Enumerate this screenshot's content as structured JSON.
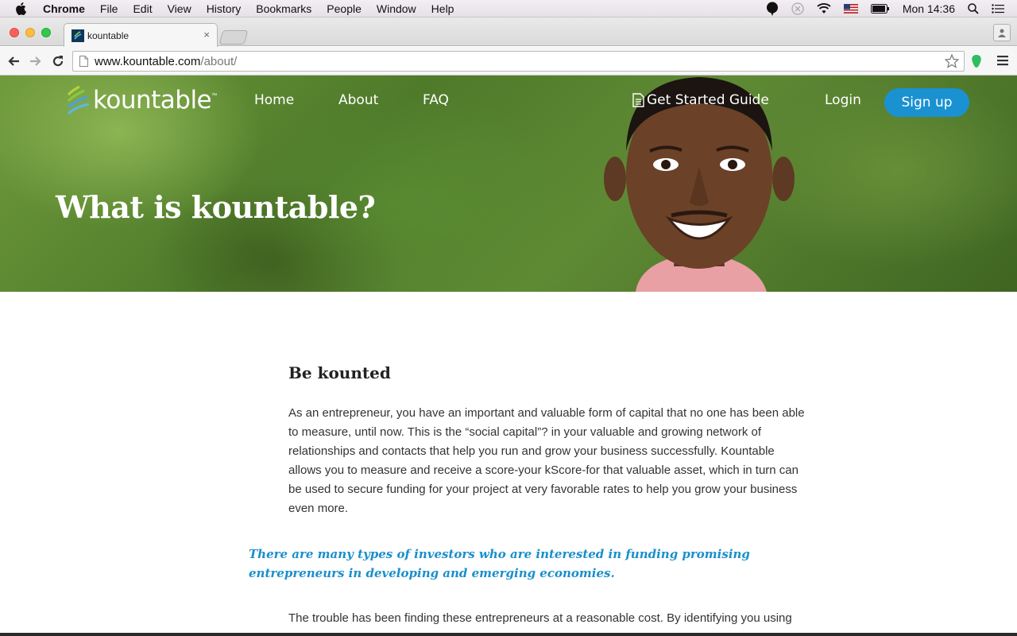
{
  "menubar": {
    "app_name": "Chrome",
    "items": [
      "File",
      "Edit",
      "View",
      "History",
      "Bookmarks",
      "People",
      "Window",
      "Help"
    ],
    "clock": "Mon 14:36"
  },
  "browser": {
    "tab_title": "kountable",
    "tab_close": "×",
    "url_host": "www.kountable.com",
    "url_path": "/about/"
  },
  "site": {
    "logo_text": "kountable",
    "logo_tm": "™",
    "nav": {
      "home": "Home",
      "about": "About",
      "faq": "FAQ",
      "guide": "Get Started Guide",
      "login": "Login",
      "signup": "Sign up"
    },
    "hero_title": "What is kountable?",
    "section_title": "Be kounted",
    "paragraph_1": "As an entrepreneur, you have an important and valuable form of capital that no one has been able to measure, until now. This is the “social capital”? in your valuable and growing network of relationships and contacts that help you run and grow your business successfully. Kountable allows you to measure and receive a score-your kScore-for that valuable asset, which in turn can be used to secure funding for your project at very favorable rates to help you grow your business even more.",
    "quote": "There are many types of investors who are interested in funding promising entrepreneurs in developing and emerging economies.",
    "paragraph_2": "The trouble has been finding these entrepreneurs at a reasonable cost. By identifying you using"
  },
  "colors": {
    "accent": "#1a91d1",
    "quote": "#1a8fcb"
  }
}
